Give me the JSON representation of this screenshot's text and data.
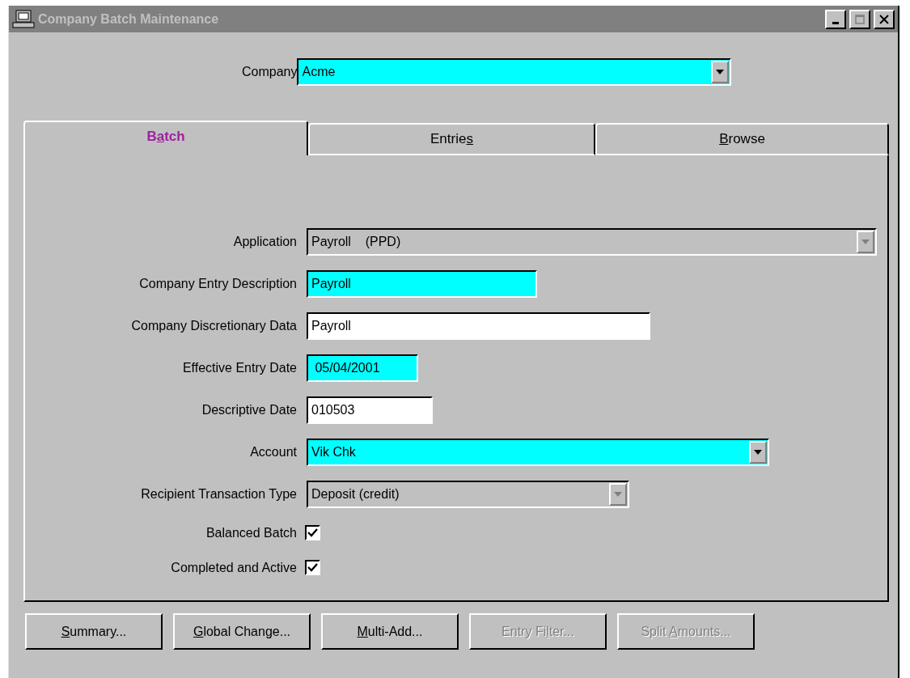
{
  "window": {
    "title": "Company Batch Maintenance",
    "active": false
  },
  "company": {
    "label": "Company",
    "value": "Acme",
    "required": true
  },
  "tabs": [
    {
      "pre": "B",
      "key": "a",
      "post": "tch",
      "selected": true
    },
    {
      "pre": "Entrie",
      "key": "s",
      "selected": false
    },
    {
      "key": "B",
      "post": "rowse",
      "selected": false
    }
  ],
  "fields": [
    {
      "kind": "dropdown",
      "label": "Application",
      "value": "Payroll    (PPD)",
      "disabled": true
    },
    {
      "kind": "text",
      "label": "Company Entry Description",
      "value": "Payroll",
      "required": true,
      "disabled": false
    },
    {
      "kind": "text",
      "label": "Company Discretionary Data",
      "value": "Payroll",
      "required": false,
      "disabled": false
    },
    {
      "kind": "text",
      "label": "Effective Entry Date",
      "value": " 05/04/2001",
      "required": true,
      "disabled": false
    },
    {
      "kind": "text",
      "label": "Descriptive Date",
      "value": "010503",
      "required": false,
      "disabled": false
    },
    {
      "kind": "dropdown",
      "label": "Account",
      "value": "Vik Chk",
      "required": true,
      "disabled": false
    },
    {
      "kind": "dropdown",
      "label": "Recipient Transaction Type",
      "value": "Deposit (credit)",
      "disabled": true
    },
    {
      "kind": "checkbox",
      "label": "Balanced Batch",
      "checked": true
    },
    {
      "kind": "checkbox",
      "label": "Completed and Active",
      "checked": true
    }
  ],
  "buttons": [
    {
      "key": "S",
      "post": "ummary...",
      "disabled": false
    },
    {
      "key": "G",
      "post": "lobal Change...",
      "disabled": false
    },
    {
      "key": "M",
      "post": "ulti-Add...",
      "disabled": false
    },
    {
      "pre": "Entry Fi",
      "key": "l",
      "post": "ter...",
      "disabled": true
    },
    {
      "pre": "Split ",
      "key": "A",
      "post": "mounts...",
      "disabled": true
    }
  ]
}
